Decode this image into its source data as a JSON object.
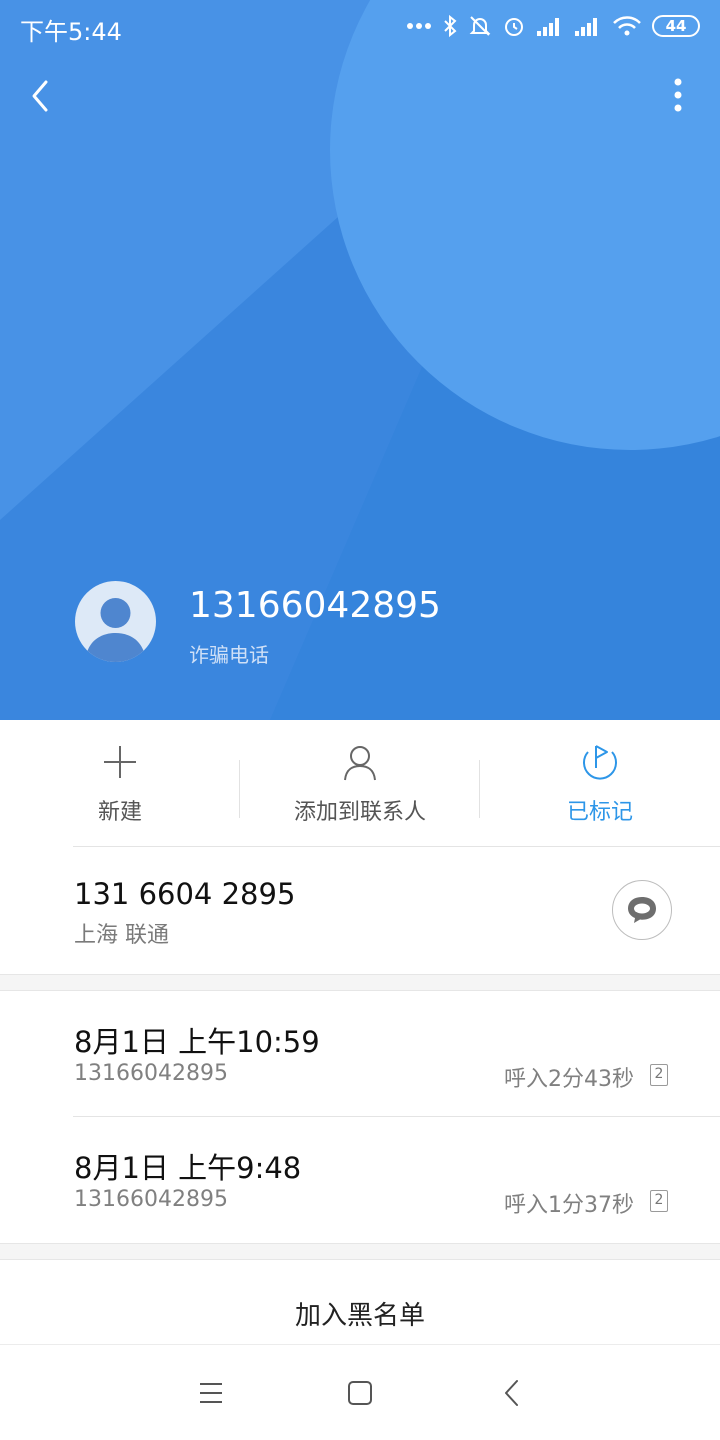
{
  "status_bar": {
    "time": "下午5:44",
    "battery": "44"
  },
  "contact": {
    "number": "13166042895",
    "tag": "诈骗电话"
  },
  "actions": [
    {
      "label": "新建",
      "icon": "plus-icon"
    },
    {
      "label": "添加到联系人",
      "icon": "person-icon"
    },
    {
      "label": "已标记",
      "icon": "flag-icon"
    }
  ],
  "number_row": {
    "formatted": "131 6604 2895",
    "location": "上海 联通"
  },
  "call_log": [
    {
      "time": "8月1日 上午10:59",
      "number": "13166042895",
      "duration": "呼入2分43秒",
      "sim": "2"
    },
    {
      "time": "8月1日 上午9:48",
      "number": "13166042895",
      "duration": "呼入1分37秒",
      "sim": "2"
    }
  ],
  "blacklist_label": "加入黑名单",
  "colors": {
    "header": "#3a86de",
    "accent": "#2d96e8"
  }
}
